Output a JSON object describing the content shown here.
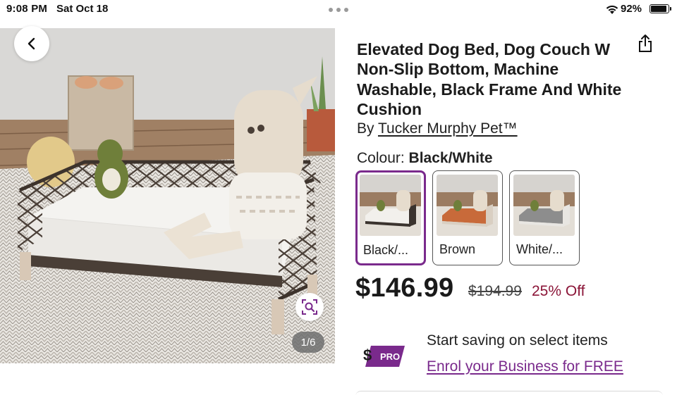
{
  "status_bar": {
    "time": "9:08 PM",
    "date": "Sat Oct 18",
    "battery_percent": "92%",
    "battery_level": 0.92
  },
  "gallery": {
    "counter": "1/6",
    "current_index": 1,
    "total": 6
  },
  "product": {
    "title_lines": [
      "Elevated Dog Bed, Dog Couch W",
      "Non-Slip Bottom, Machine",
      "Washable, Black Frame And White",
      "Cushion"
    ],
    "by_prefix": "By",
    "brand": "Tucker Murphy Pet™",
    "colour_label": "Colour:",
    "colour_value": "Black/White",
    "swatches": [
      {
        "label": "Black/...",
        "selected": true,
        "cushion_color": "#f2f0ec",
        "frame_color": "#3a332e"
      },
      {
        "label": "Brown",
        "selected": false,
        "cushion_color": "#c86a3a",
        "frame_color": "#d9cfc2"
      },
      {
        "label": "White/...",
        "selected": false,
        "cushion_color": "#8d8d8d",
        "frame_color": "#e8e6e2"
      }
    ],
    "price": "$146.99",
    "old_price": "$194.99",
    "discount": "25% Off"
  },
  "promo": {
    "badge_symbol": "$",
    "badge_text": "PRO",
    "line": "Start saving on select items",
    "link": "Enrol your Business for FREE"
  },
  "colors": {
    "accent_purple": "#7a2a8c",
    "discount_red": "#8b1538",
    "text_dark": "#1a1a1a"
  },
  "icons": {
    "back": "chevron-left-icon",
    "share": "share-icon",
    "zoom": "visual-search-icon",
    "wifi": "wifi-icon",
    "battery": "battery-icon"
  }
}
